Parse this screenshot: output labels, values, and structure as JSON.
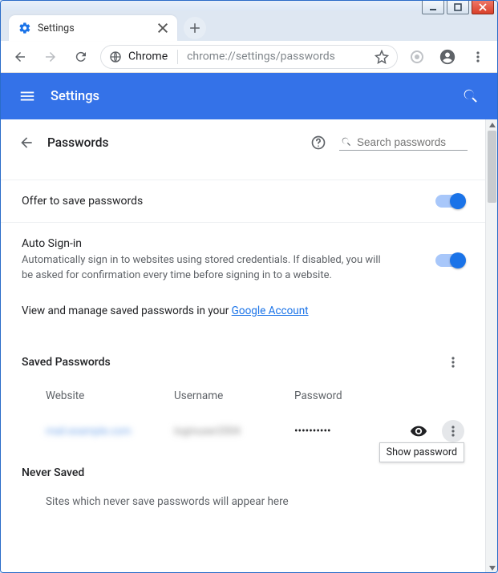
{
  "window": {
    "tab_title": "Settings"
  },
  "toolbar": {
    "product": "Chrome",
    "url_path": "chrome://settings/passwords"
  },
  "header": {
    "title": "Settings"
  },
  "page": {
    "title": "Passwords",
    "search_placeholder": "Search passwords"
  },
  "offers": {
    "save_label": "Offer to save passwords",
    "autosignin_label": "Auto Sign-in",
    "autosignin_desc": "Automatically sign in to websites using stored credentials. If disabled, you will be asked for confirmation every time before signing in to a website.",
    "view_manage_prefix": "View and manage saved passwords in your ",
    "view_manage_link": "Google Account"
  },
  "saved": {
    "heading": "Saved Passwords",
    "col_site": "Website",
    "col_user": "Username",
    "col_pass": "Password",
    "rows": [
      {
        "site": "mail.example.com",
        "user": "loginuser2004",
        "pass_mask": "••••••••••"
      }
    ],
    "tooltip": "Show password"
  },
  "never": {
    "heading": "Never Saved",
    "desc": "Sites which never save passwords will appear here"
  }
}
